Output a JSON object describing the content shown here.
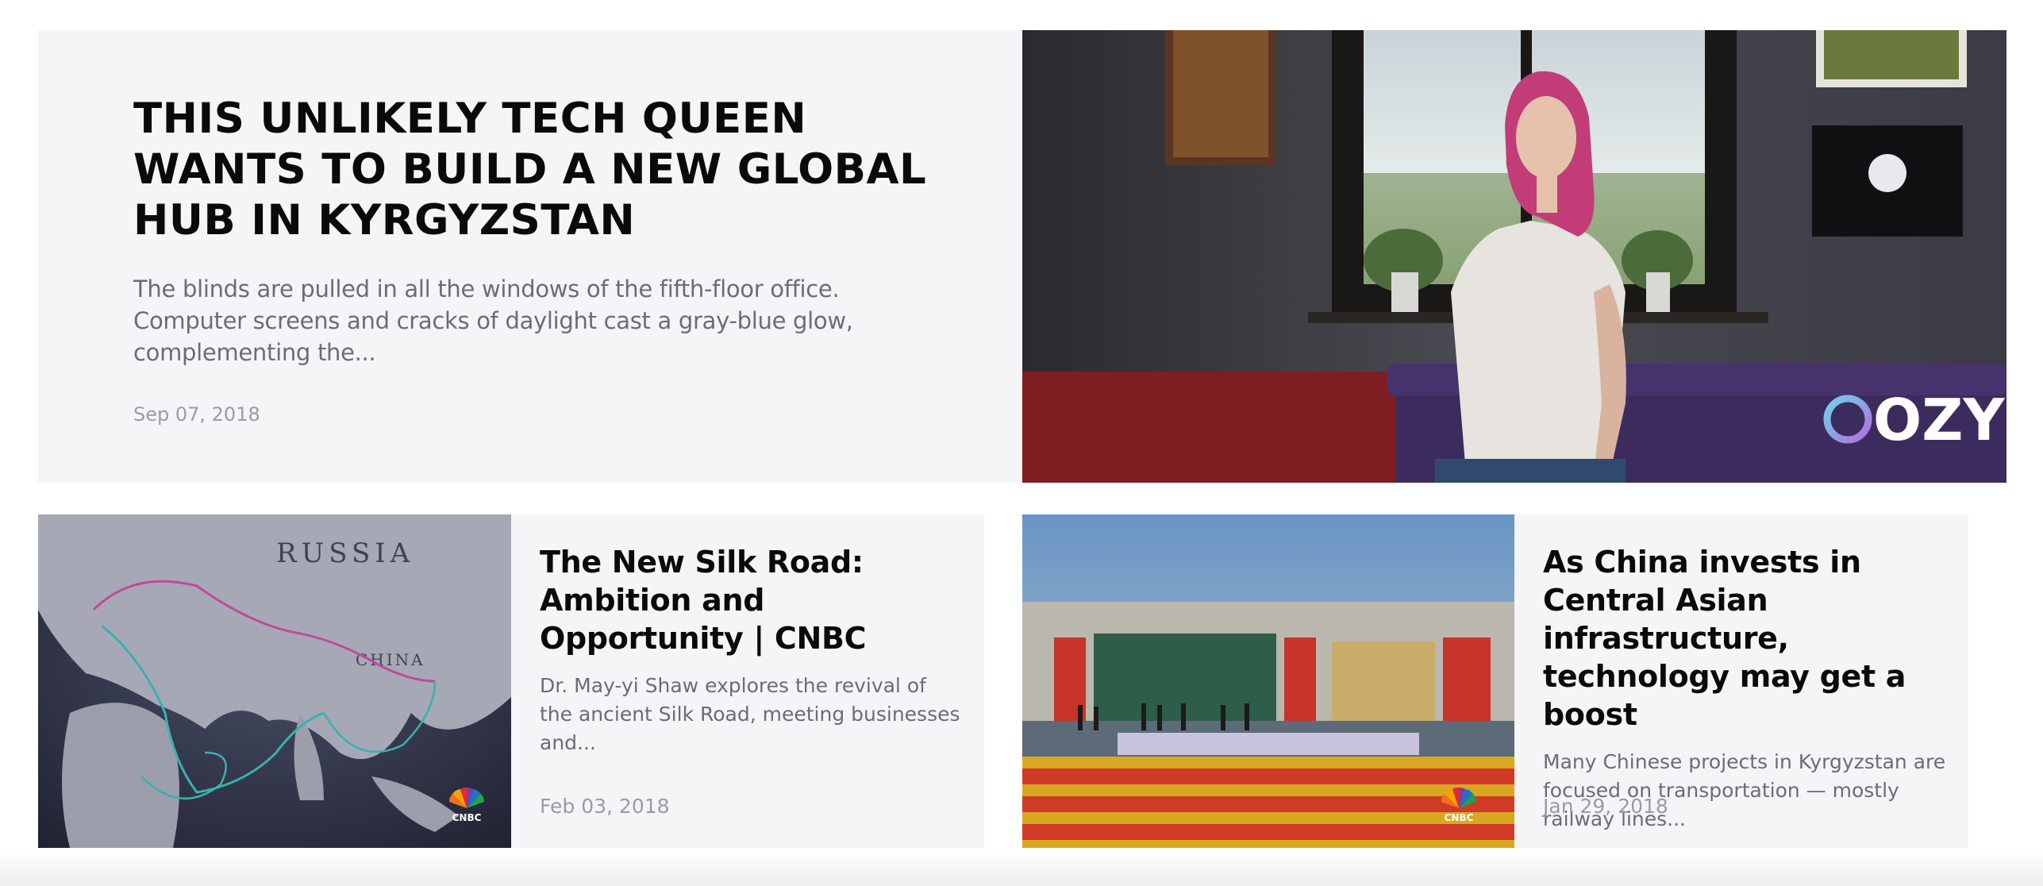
{
  "featured": {
    "title": "THIS UNLIKELY TECH QUEEN WANTS TO BUILD A NEW GLOBAL HUB IN KYRGYZSTAN",
    "excerpt": "The blinds are pulled in all the windows of the fifth-floor office. Computer screens and cracks of daylight cast a gray-blue glow, complementing the...",
    "date": "Sep 07, 2018",
    "image_brand": "OZY"
  },
  "articles": [
    {
      "title": "The New Silk Road: Ambition and Opportunity | CNBC",
      "excerpt": "Dr. May-yi Shaw explores the revival of the ancient Silk Road, meeting businesses and...",
      "date": "Feb 03, 2018",
      "map_label": "RUSSIA",
      "map_label_2": "CHINA",
      "image_brand": "CNBC"
    },
    {
      "title": "As China invests in Central Asian infrastructure, technology may get a boost",
      "excerpt": "Many Chinese projects in Kyrgyzstan are focused on transportation — mostly railway lines...",
      "date": "Jan 29, 2018",
      "image_brand": "CNBC"
    }
  ]
}
